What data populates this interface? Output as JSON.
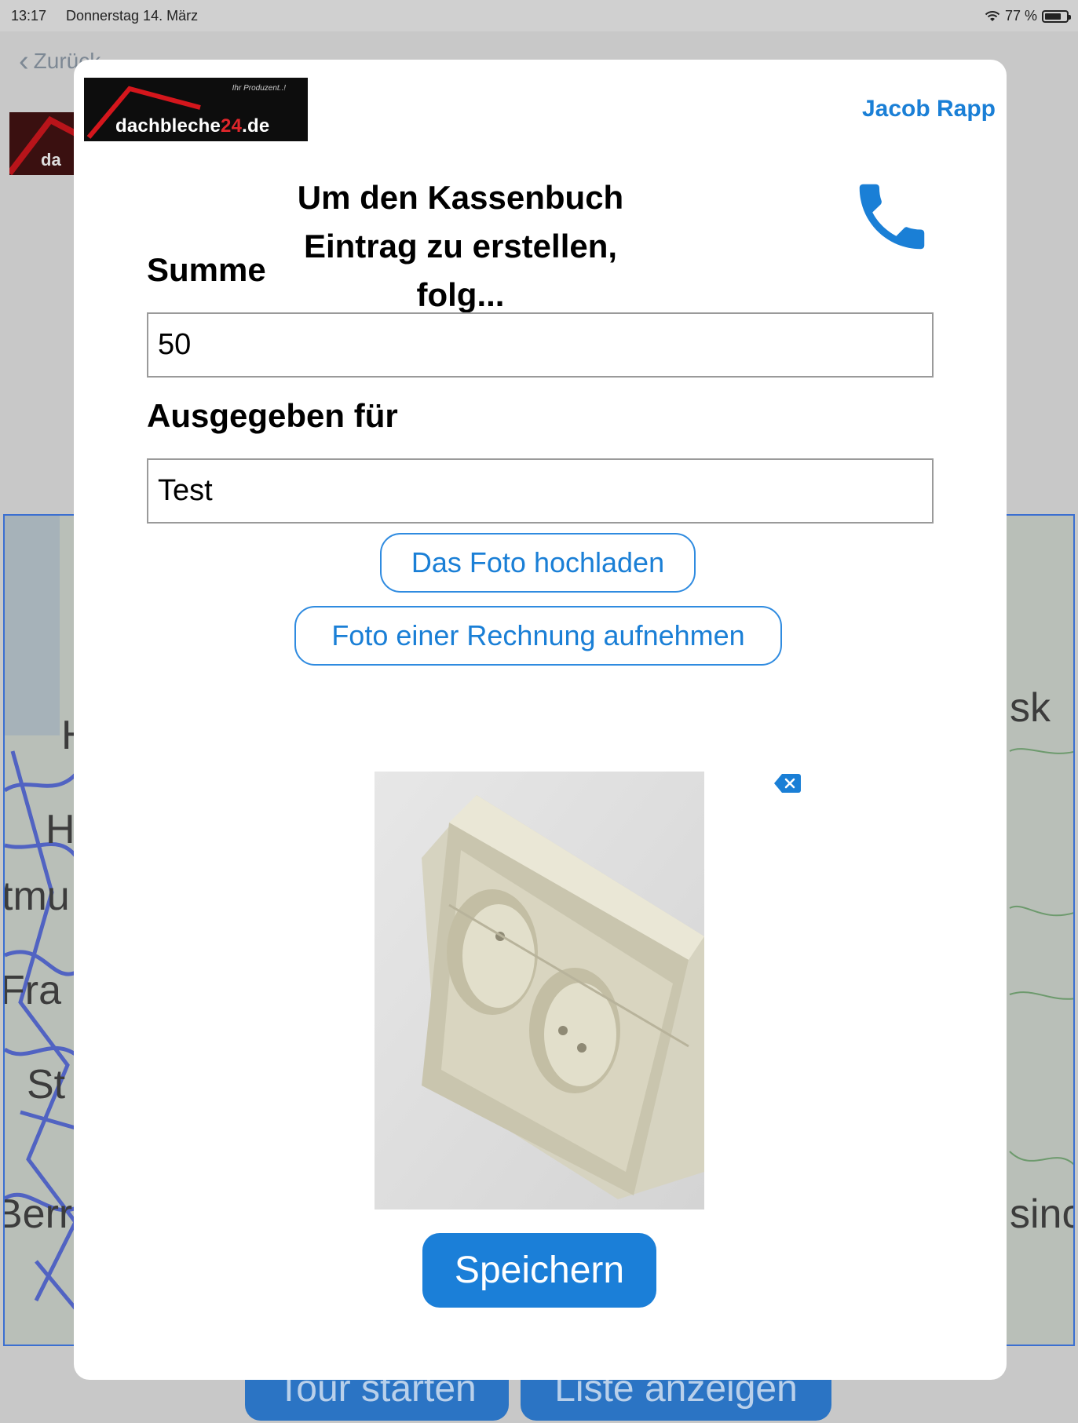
{
  "status_bar": {
    "time": "13:17",
    "date": "Donnerstag 14. März",
    "battery": "77 %",
    "battery_level": 0.77
  },
  "background": {
    "back_label": "Zurück",
    "logo_text": "da",
    "map_places": [
      "H",
      "H",
      "tmu",
      "Fra",
      "St",
      "Berr",
      "sk",
      "sinc"
    ],
    "buttons": {
      "tour": "Tour starten",
      "list": "Liste anzeigen"
    }
  },
  "modal": {
    "logo": {
      "tagline": "Ihr Produzent..!",
      "brand_prefix": "dachbleche",
      "brand_number": "24",
      "brand_suffix": ".de"
    },
    "user_name": "Jacob Rapp",
    "title_line1": "Um den Kassenbuch",
    "title_line2": "Eintrag zu erstellen, folg...",
    "sum_label": "Summe",
    "sum_value": "50",
    "purpose_label": "Ausgegeben für",
    "purpose_value": "Test",
    "upload_button": "Das Foto hochladen",
    "camera_button": "Foto einer Rechnung aufnehmen",
    "save_button": "Speichern"
  },
  "colors": {
    "accent": "#1a7fd6",
    "brand_red": "#e0262b",
    "overlay_bg": "#c8c8c8"
  },
  "icons": [
    "wifi-icon",
    "battery-icon",
    "back-chevron-icon",
    "phone-icon",
    "delete-photo-icon"
  ]
}
